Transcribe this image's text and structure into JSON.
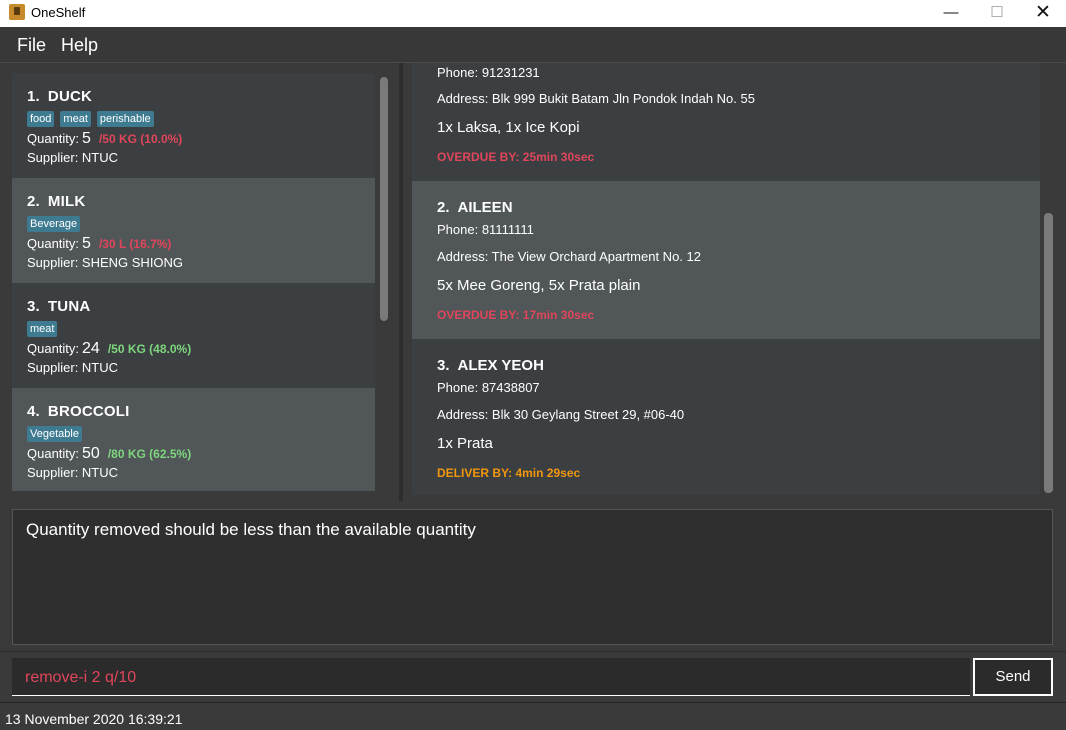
{
  "window": {
    "title": "OneShelf",
    "minimize": "—",
    "maximize": "☐",
    "close": "✕"
  },
  "menu": {
    "file": "File",
    "help": "Help"
  },
  "items": [
    {
      "num": "1.",
      "name": "DUCK",
      "tags": [
        "food",
        "meat",
        "perishable"
      ],
      "qty_label": "Quantity:",
      "qty": "5",
      "ratio": "/50 KG (10.0%)",
      "ratio_color": "red",
      "supplier": "Supplier: NTUC"
    },
    {
      "num": "2.",
      "name": "MILK",
      "tags": [
        "Beverage"
      ],
      "qty_label": "Quantity:",
      "qty": "5",
      "ratio": "/30 L (16.7%)",
      "ratio_color": "red",
      "supplier": "Supplier: SHENG SHIONG"
    },
    {
      "num": "3.",
      "name": "TUNA",
      "tags": [
        "meat"
      ],
      "qty_label": "Quantity:",
      "qty": "24",
      "ratio": "/50 KG (48.0%)",
      "ratio_color": "green",
      "supplier": "Supplier: NTUC"
    },
    {
      "num": "4.",
      "name": "BROCCOLI",
      "tags": [
        "Vegetable"
      ],
      "qty_label": "Quantity:",
      "qty": "50",
      "ratio": "/80 KG (62.5%)",
      "ratio_color": "green",
      "supplier": "Supplier: NTUC"
    }
  ],
  "orders": [
    {
      "phone": "Phone: 91231231",
      "address": "Address: Blk 999 Bukit Batam Jln Pondok Indah No. 55",
      "items": "1x Laksa, 1x Ice Kopi",
      "status": "OVERDUE BY: 25min 30sec"
    },
    {
      "num": "2.",
      "name": "AILEEN",
      "phone": "Phone: 81111111",
      "address": "Address: The View Orchard Apartment No. 12",
      "items": "5x Mee Goreng, 5x Prata plain",
      "status": "OVERDUE BY: 17min 30sec"
    },
    {
      "num": "3.",
      "name": "ALEX YEOH",
      "phone": "Phone: 87438807",
      "address": "Address: Blk 30 Geylang Street 29, #06-40",
      "items": "1x Prata",
      "status": "DELIVER BY: 4min 29sec"
    }
  ],
  "result": "Quantity removed should be less than the available quantity",
  "command": {
    "value": "remove-i 2 q/10",
    "send_label": "Send"
  },
  "status": "13 November 2020 16:39:21",
  "colors": {
    "overdue": "#e0465b",
    "deliver": "#f0960e",
    "ok": "#7ed67e",
    "tag": "#3e7b91"
  }
}
